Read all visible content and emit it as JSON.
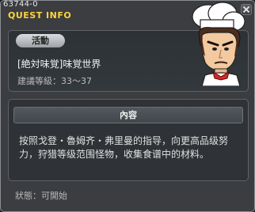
{
  "window": {
    "quest_id": "63744-0",
    "title": "QUEST INFO"
  },
  "quest": {
    "category": "活動",
    "name": "[絶対味覚]味覚世界",
    "level": "建議等級：33～37"
  },
  "content": {
    "header": "內容",
    "body": "按照戈登・魯姆齐・弗里曼的指导，向更高品级努力，狩猎等级范围怪物，收集食谱中的材料。"
  },
  "status": {
    "text": "狀態：可開始"
  },
  "colors": {
    "title": "#ffd43a",
    "background": "#3b3d40",
    "panel": "#2f3236"
  },
  "icons": {
    "close": "close-icon",
    "npc": "chef-npc-portrait"
  }
}
